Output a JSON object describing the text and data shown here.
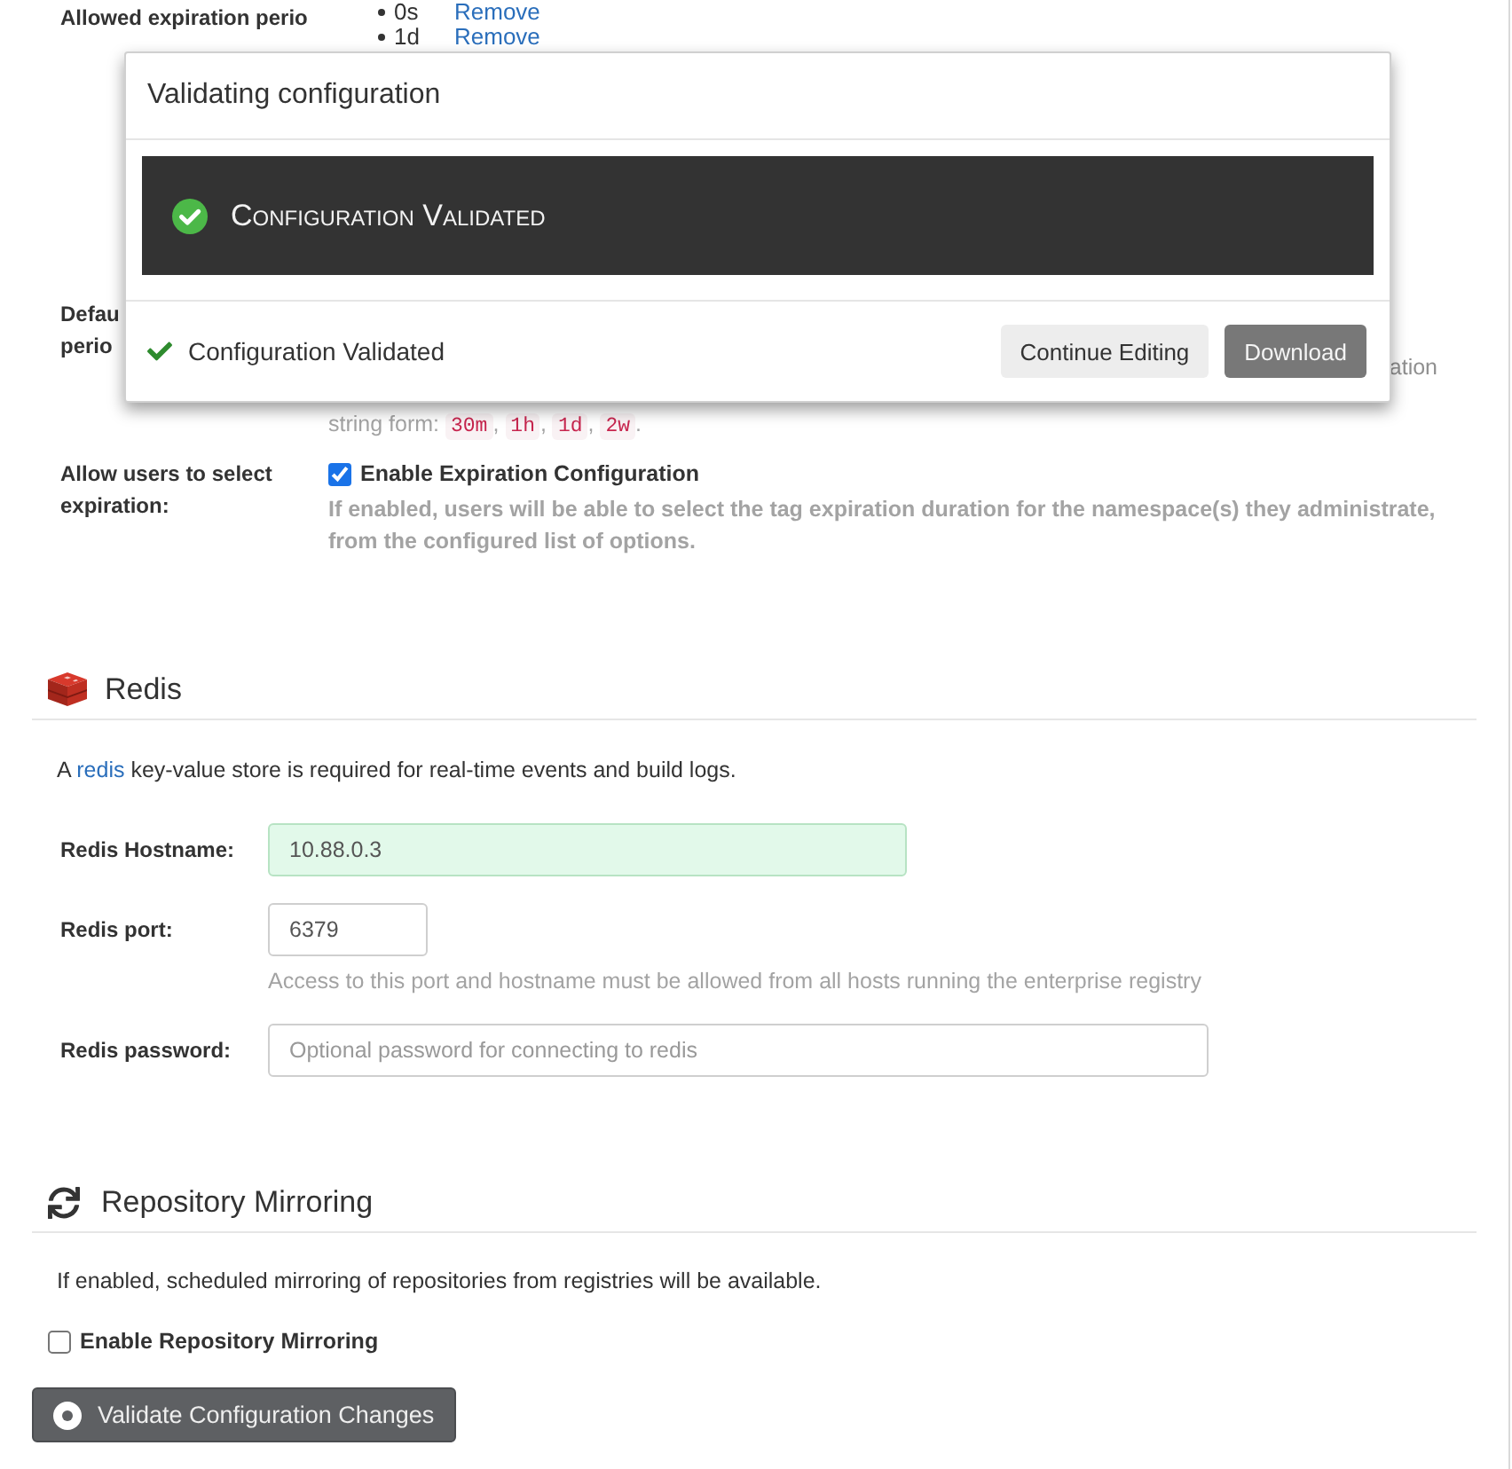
{
  "expiration_options": {
    "label": "Allowed expiration perio",
    "items": [
      {
        "value": "0s",
        "action": "Remove"
      },
      {
        "value": "1d",
        "action": "Remove"
      }
    ]
  },
  "default_expiration": {
    "label": "Defau perio",
    "help_tail": "ation",
    "help": [
      {
        "kind": "text",
        "text": "string form: "
      },
      {
        "kind": "code",
        "text": "30m"
      },
      {
        "kind": "text",
        "text": ", "
      },
      {
        "kind": "code",
        "text": "1h"
      },
      {
        "kind": "text",
        "text": ", "
      },
      {
        "kind": "code",
        "text": "1d"
      },
      {
        "kind": "text",
        "text": ", "
      },
      {
        "kind": "code",
        "text": "2w"
      },
      {
        "kind": "text",
        "text": "."
      }
    ]
  },
  "expiration_selection": {
    "label": "Allow users to select expiration:",
    "checkbox": {
      "label": "Enable Expiration Configuration",
      "checked": true
    },
    "help": "If enabled, users will be able to select the tag expiration duration for the namespace(s) they administrate, from the configured list of options."
  },
  "redis": {
    "title": "Redis",
    "description": {
      "before": "A ",
      "link": "redis",
      "after": " key-value store is required for real-time events and build logs."
    },
    "fields": [
      {
        "kind": "text",
        "label": "Redis Hostname:",
        "value": "10.88.0.3",
        "valid": true
      },
      {
        "kind": "number",
        "label": "Redis port:",
        "value": "6379",
        "valid": false,
        "help": "Access to this port and hostname must be allowed from all hosts running the enterprise registry"
      },
      {
        "kind": "password",
        "label": "Redis password:",
        "placeholder": "Optional password for connecting to redis",
        "valid": false
      }
    ]
  },
  "mirroring": {
    "title": "Repository Mirroring",
    "description": "If enabled, scheduled mirroring of repositories from registries will be available.",
    "checkbox": {
      "label": "Enable Repository Mirroring",
      "checked": false
    }
  },
  "validate_button": {
    "label": "Validate Configuration Changes"
  },
  "modal": {
    "title": "Validating configuration",
    "banner": "Configuration Validated",
    "status": "Configuration Validated",
    "buttons": [
      {
        "kind": "default",
        "label": "Continue Editing"
      },
      {
        "kind": "primary",
        "label": "Download"
      }
    ]
  }
}
